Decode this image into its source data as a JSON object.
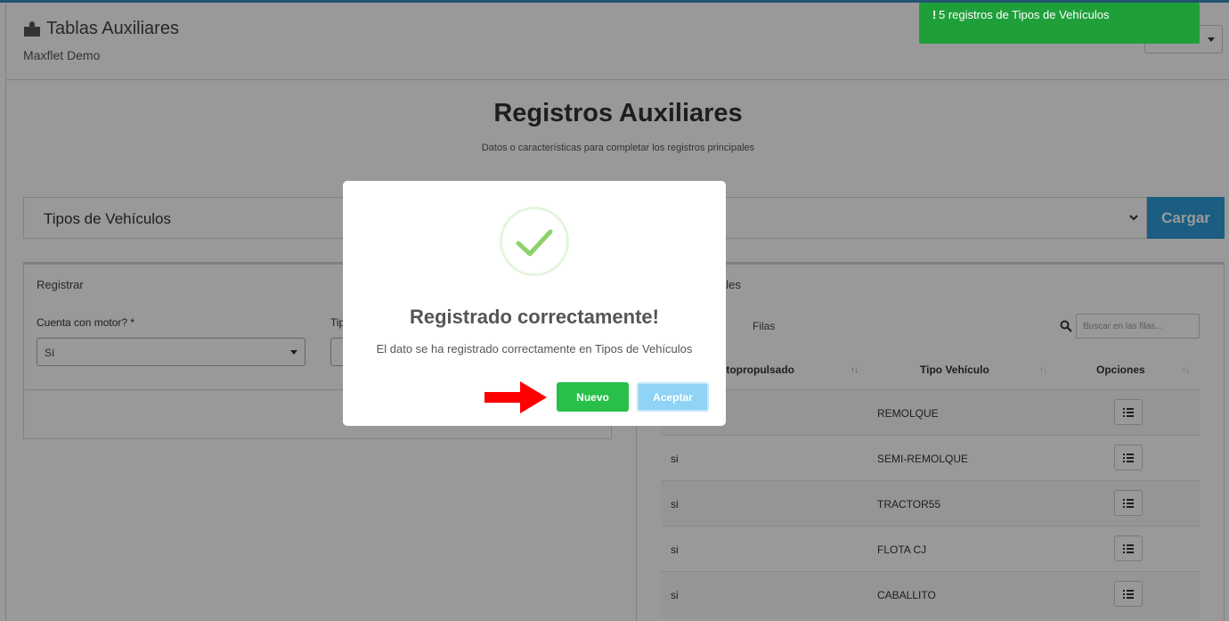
{
  "header": {
    "title": "Tablas Auxiliares",
    "subtitle": "Maxflet Demo"
  },
  "page": {
    "title": "Registros Auxiliares",
    "subtitle": "Datos o características para completar los registros principales"
  },
  "table_selector": {
    "value": "Tipos de Vehículos",
    "button_label": "Cargar"
  },
  "register_box": {
    "title": "Registrar",
    "field1_label": "Cuenta con motor? *",
    "field1_value": "Sí",
    "field2_label_partial": "Tip"
  },
  "list_box": {
    "title_partial": "ales",
    "rows_label": "Filas",
    "search_placeholder": "Buscar en las filas...",
    "columns": [
      "utopropulsado",
      "Tipo Vehículo",
      "Opciones"
    ],
    "rows": [
      {
        "motor": "",
        "tipo": "REMOLQUE"
      },
      {
        "motor": "si",
        "tipo": "SEMI-REMOLQUE"
      },
      {
        "motor": "si",
        "tipo": "TRACTOR55"
      },
      {
        "motor": "si",
        "tipo": "FLOTA CJ"
      },
      {
        "motor": "si",
        "tipo": "CABALLITO"
      }
    ]
  },
  "toast": {
    "mark": "!",
    "message": "5 registros de Tipos de Vehículos"
  },
  "modal": {
    "title": "Registrado correctamente!",
    "text": "El dato se ha registrado correctamente en Tipos de Vehículos",
    "primary_label": "Nuevo",
    "secondary_label": "Aceptar"
  },
  "colors": {
    "accent": "#2e9dd7",
    "toast": "#1f9f3a",
    "nuevo": "#28c04b",
    "aceptar": "#8fd3f5",
    "check": "#8fd26c",
    "arrow": "#ff0000"
  },
  "icons": [
    "puzzle-icon",
    "chevron-down-icon",
    "search-icon",
    "list-icon",
    "check-icon",
    "arrow-right-icon"
  ]
}
